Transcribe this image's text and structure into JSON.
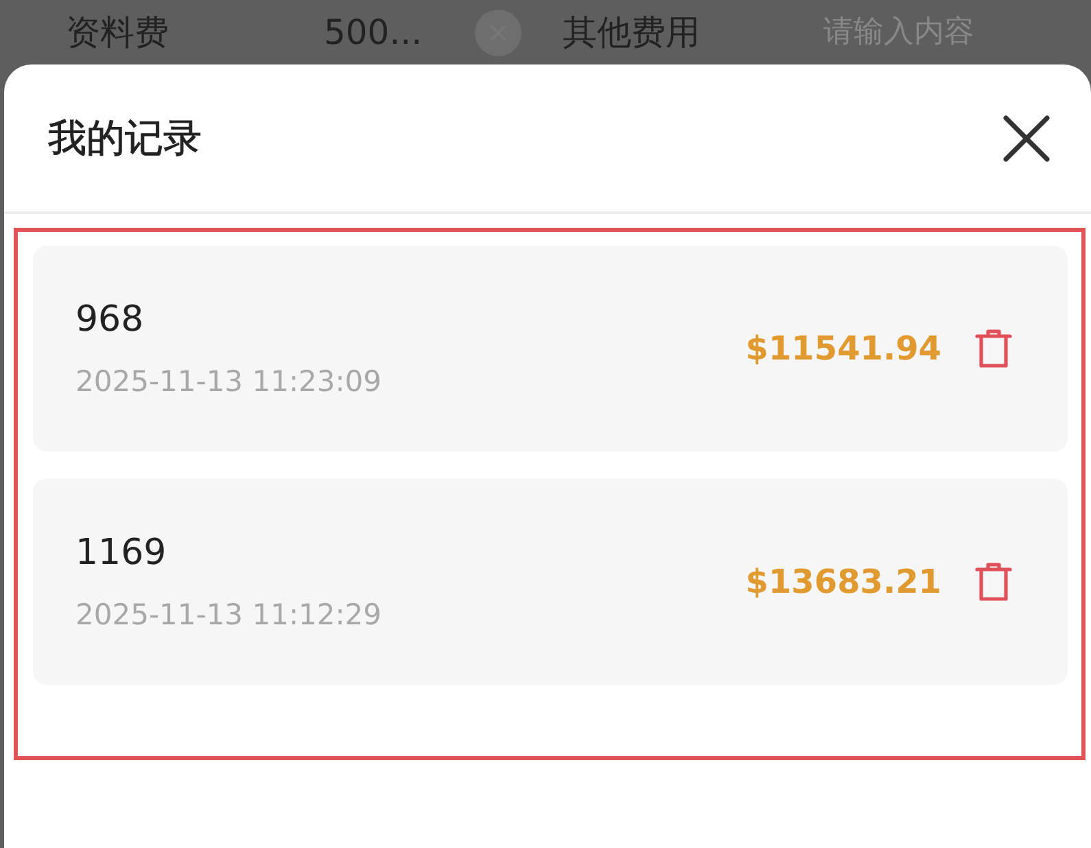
{
  "background_form": {
    "fields": [
      {
        "label": "资料费",
        "value": "500...",
        "clearable": true
      },
      {
        "label": "其他费用",
        "placeholder": "请输入内容",
        "clearable": false
      }
    ]
  },
  "sheet": {
    "title": "我的记录",
    "records": [
      {
        "name": "968",
        "time": "2025-11-13 11:23:09",
        "amount": "$11541.94"
      },
      {
        "name": "1169",
        "time": "2025-11-13 11:12:29",
        "amount": "$13683.21"
      }
    ]
  }
}
